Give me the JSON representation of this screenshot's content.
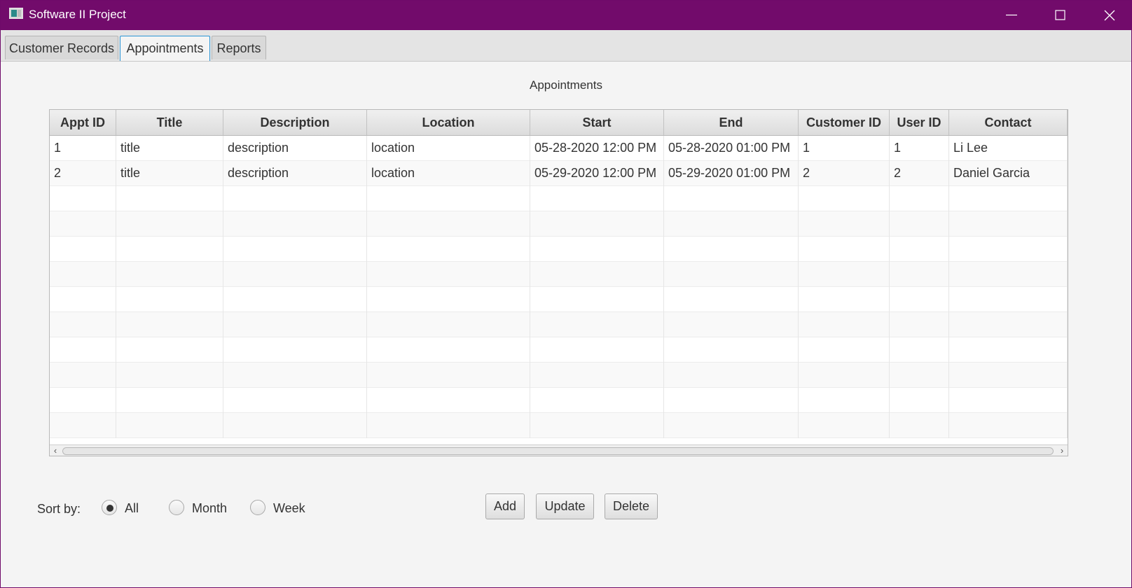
{
  "window": {
    "title": "Software II Project"
  },
  "tabs": [
    {
      "label": "Customer Records",
      "active": false
    },
    {
      "label": "Appointments",
      "active": true
    },
    {
      "label": "Reports",
      "active": false
    }
  ],
  "section_title": "Appointments",
  "table": {
    "columns": [
      "Appt ID",
      "Title",
      "Description",
      "Location",
      "Start",
      "End",
      "Customer ID",
      "User ID",
      "Contact"
    ],
    "rows": [
      [
        "1",
        "title",
        "description",
        "location",
        "05-28-2020 12:00 PM",
        "05-28-2020 01:00 PM",
        "1",
        "1",
        "Li Lee"
      ],
      [
        "2",
        "title",
        "description",
        "location",
        "05-29-2020 12:00 PM",
        "05-29-2020 01:00 PM",
        "2",
        "2",
        "Daniel Garcia"
      ]
    ]
  },
  "sort": {
    "label": "Sort by:",
    "options": [
      {
        "label": "All",
        "selected": true
      },
      {
        "label": "Month",
        "selected": false
      },
      {
        "label": "Week",
        "selected": false
      }
    ]
  },
  "buttons": {
    "add": "Add",
    "update": "Update",
    "delete": "Delete"
  }
}
